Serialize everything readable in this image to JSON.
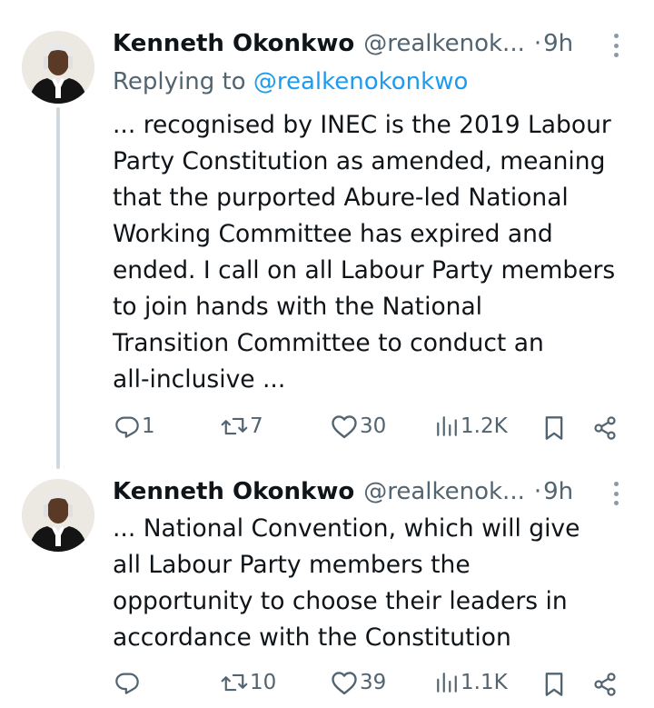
{
  "tweets": [
    {
      "author_name": "Kenneth Okonkwo",
      "handle": "@realkenok...",
      "separator": "·",
      "time": "9h",
      "replying_prefix": "Replying to",
      "replying_handle": "@realkenokonkwo",
      "text_lines": [
        "... recognised by INEC is the 2019 Labour",
        "Party Constitution as amended, meaning",
        "that the purported Abure-led National",
        "Working Committee has expired and",
        "ended. I call on all Labour Party members",
        "to join hands with the National",
        "Transition Committee to conduct an",
        "all-inclusive ..."
      ],
      "actions": {
        "replies": "1",
        "retweets": "7",
        "likes": "30",
        "views": "1.2K"
      }
    },
    {
      "author_name": "Kenneth Okonkwo",
      "handle": "@realkenok...",
      "separator": "·",
      "time": "9h",
      "text_lines": [
        "... National Convention, which will give",
        "all Labour Party members the",
        "opportunity to choose their leaders in",
        "accordance with the Constitution"
      ],
      "actions": {
        "replies": "",
        "retweets": "10",
        "likes": "39",
        "views": "1.1K"
      }
    }
  ],
  "icons": {
    "reply": "reply-icon",
    "retweet": "retweet-icon",
    "like": "heart-icon",
    "views": "views-icon",
    "bookmark": "bookmark-icon",
    "share": "share-icon",
    "more": "more-icon"
  },
  "colors": {
    "text": "#0f1419",
    "muted": "#536471",
    "link": "#1d9bf0",
    "thread_line": "#cfd9de"
  }
}
